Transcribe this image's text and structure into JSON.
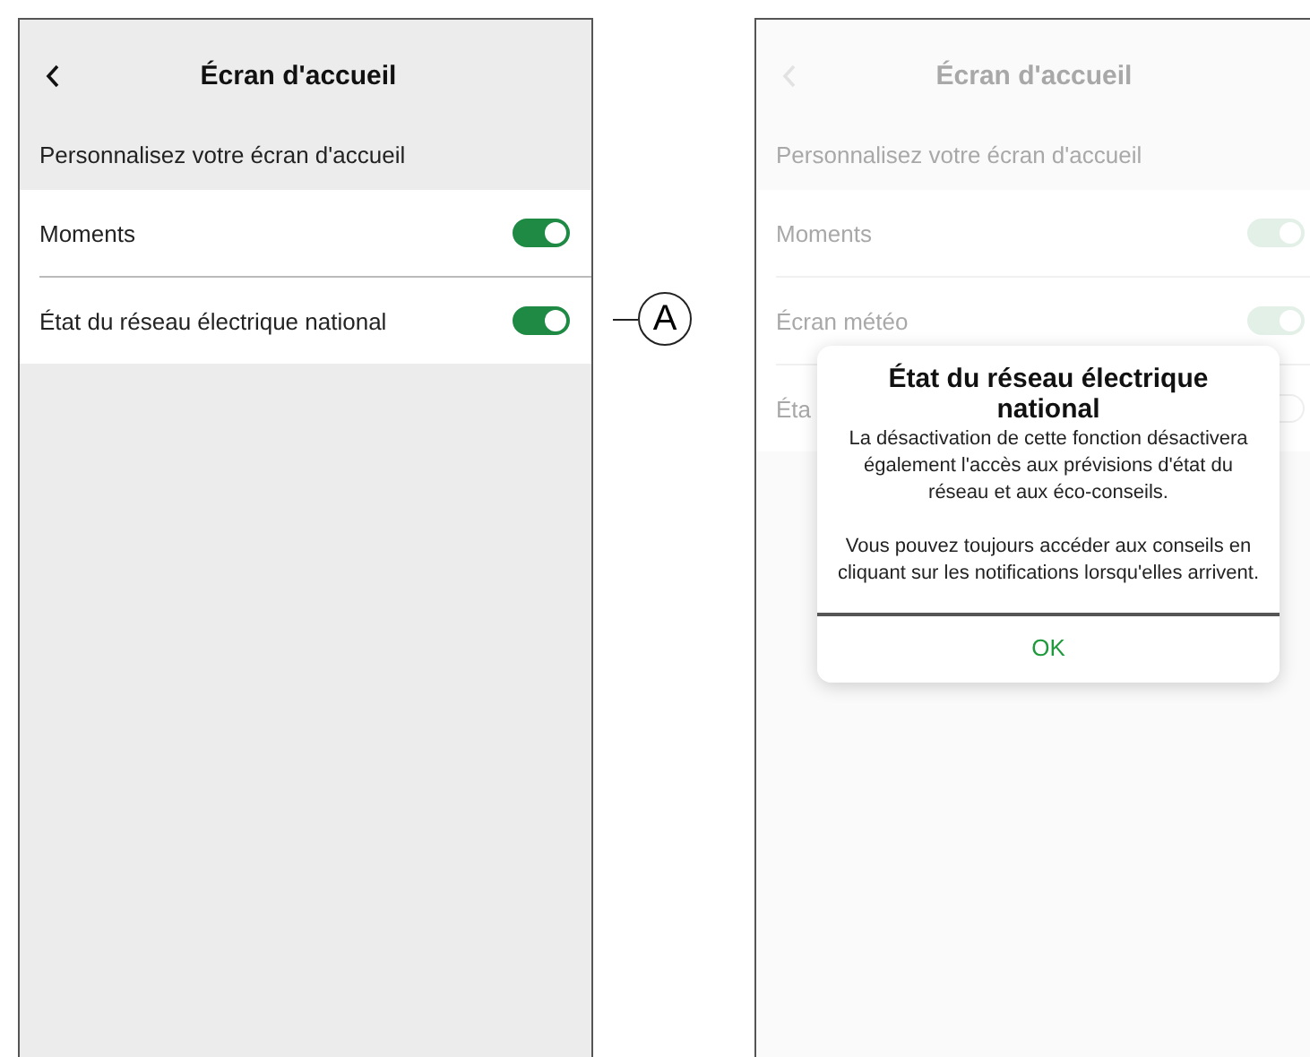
{
  "screens": [
    {
      "title": "Écran d'accueil",
      "subtitle": "Personnalisez votre écran d'accueil",
      "dimmed": false,
      "rows": [
        {
          "label": "Moments",
          "on": true,
          "callout": ""
        },
        {
          "label": "État du réseau électrique national",
          "on": true,
          "callout": "A"
        }
      ]
    },
    {
      "title": "Écran d'accueil",
      "subtitle": "Personnalisez votre écran d'accueil",
      "dimmed": true,
      "rows": [
        {
          "label": "Moments",
          "on": true,
          "callout": ""
        },
        {
          "label": "Écran météo",
          "on": true,
          "callout": ""
        },
        {
          "label": "Éta",
          "on": false,
          "callout": ""
        }
      ],
      "dialog": {
        "title": "État du réseau électrique national",
        "paragraphs": [
          "La désactivation de cette fonction désactivera également l'accès aux prévisions d'état du réseau et aux éco-conseils.",
          "Vous pouvez toujours accéder aux conseils en cliquant sur les notifications lorsqu'elles arrivent."
        ],
        "button": "OK"
      }
    }
  ]
}
